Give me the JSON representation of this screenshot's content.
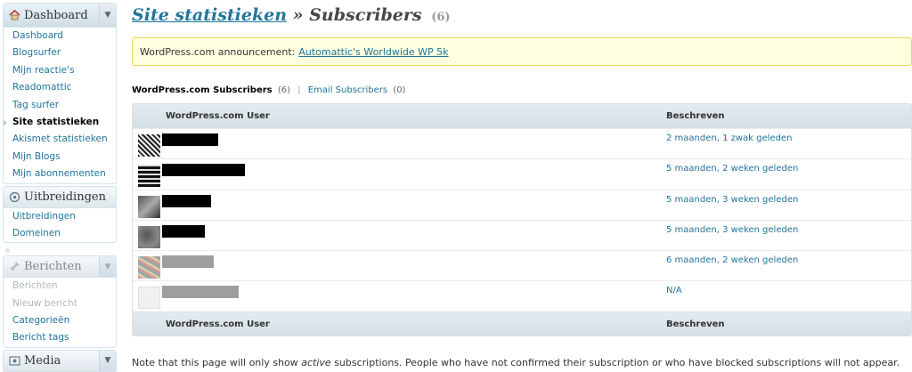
{
  "sidebar": {
    "dashboard": {
      "heading": "Dashboard",
      "items": [
        "Dashboard",
        "Blogsurfer",
        "Mijn reactie's",
        "Readomattic",
        "Tag surfer",
        "Site statistieken",
        "Akismet statistieken",
        "Mijn Blogs",
        "Mijn abonnementen"
      ]
    },
    "uitbreidingen": {
      "heading": "Uitbreidingen",
      "items": [
        "Uitbreidingen",
        "Domeinen"
      ]
    },
    "berichten": {
      "heading": "Berichten",
      "items": [
        "Berichten",
        "Nieuw bericht",
        "Categorieën",
        "Bericht tags"
      ]
    },
    "media": {
      "heading": "Media"
    }
  },
  "header": {
    "crumb": "Site statistieken",
    "separator": "»",
    "title": "Subscribers",
    "count": "(6)"
  },
  "announcement": {
    "prefix": "WordPress.com announcement:",
    "link": "Automattic's Worldwide WP 5k"
  },
  "subnav": {
    "current": "WordPress.com Subscribers",
    "current_count": "(6)",
    "separator": "|",
    "other": "Email Subscribers",
    "other_count": "(0)"
  },
  "table": {
    "columns": [
      "WordPress.com User",
      "Beschreven"
    ],
    "rows": [
      {
        "since": "2 maanden, 1 zwak geleden"
      },
      {
        "since": "5 maanden, 2 weken geleden"
      },
      {
        "since": "5 maanden, 3 weken geleden"
      },
      {
        "since": "5 maanden, 3 weken geleden"
      },
      {
        "since": "6 maanden, 2 weken geleden"
      },
      {
        "since": "N/A"
      }
    ]
  },
  "note": {
    "before": "Note that this page will only show ",
    "emphasis": "active",
    "after": " subscriptions. People who have not confirmed their subscription or who have blocked subscriptions will not appear."
  }
}
